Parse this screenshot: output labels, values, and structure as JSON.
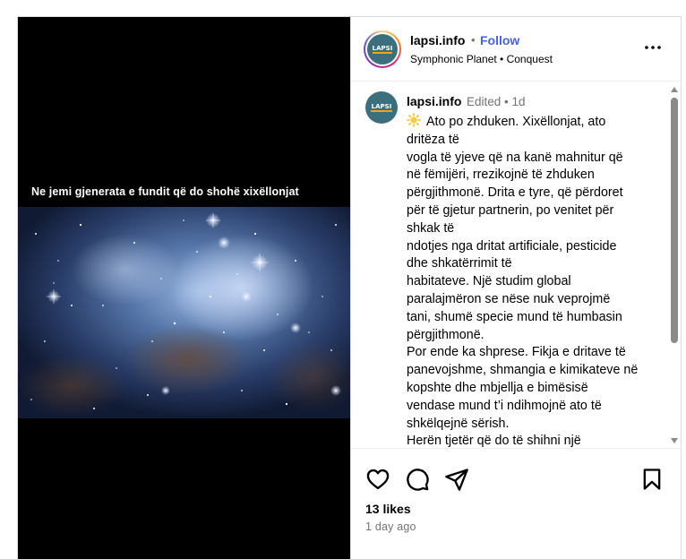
{
  "media": {
    "overlay_text": "Ne jemi gjenerata e fundit që do shohë xixëllonjat"
  },
  "header": {
    "username": "lapsi.info",
    "separator": "•",
    "follow_label": "Follow",
    "subtitle": "Symphonic Planet • Conquest",
    "avatar_text": "LAPSI"
  },
  "caption": {
    "username": "lapsi.info",
    "meta": "Edited • 1d",
    "emoji_icon": "sun-icon",
    "lines": [
      "Ato po zhduken. Xixëllonjat, ato",
      "dritëza të",
      "vogla të yjeve që na kanë mahnitur që",
      "në fëmijëri, rrezikojnë të zhduken",
      "përgjithmonë. Drita e tyre, që përdoret",
      "për të gjetur partnerin, po venitet për",
      "shkak të",
      "ndotjes nga dritat artificiale, pesticide",
      "dhe shkatërrimit të",
      "habitateve. Një studim global",
      "paralajmëron se nëse nuk veprojmë",
      "tani, shumë specie mund të humbasin",
      "përgjithmonë.",
      "Por ende ka shprese. Fikja e dritave të",
      "panevojshme, shmangia e kimikateve në",
      "kopshte dhe mbjellja e bimësisë",
      "vendase mund t’i ndihmojnë ato të",
      "shkëlqejnë sërish.",
      "Herën tjetër që do të shihni një"
    ]
  },
  "actions": {
    "icons": [
      "heart-icon",
      "comment-icon",
      "share-icon",
      "bookmark-icon"
    ]
  },
  "stats": {
    "likes": "13 likes",
    "time_ago": "1 day ago"
  },
  "colors": {
    "follow": "#4262e6",
    "muted": "#737373",
    "brand_teal": "#3c6f7d",
    "brand_orange": "#f3a21b"
  }
}
